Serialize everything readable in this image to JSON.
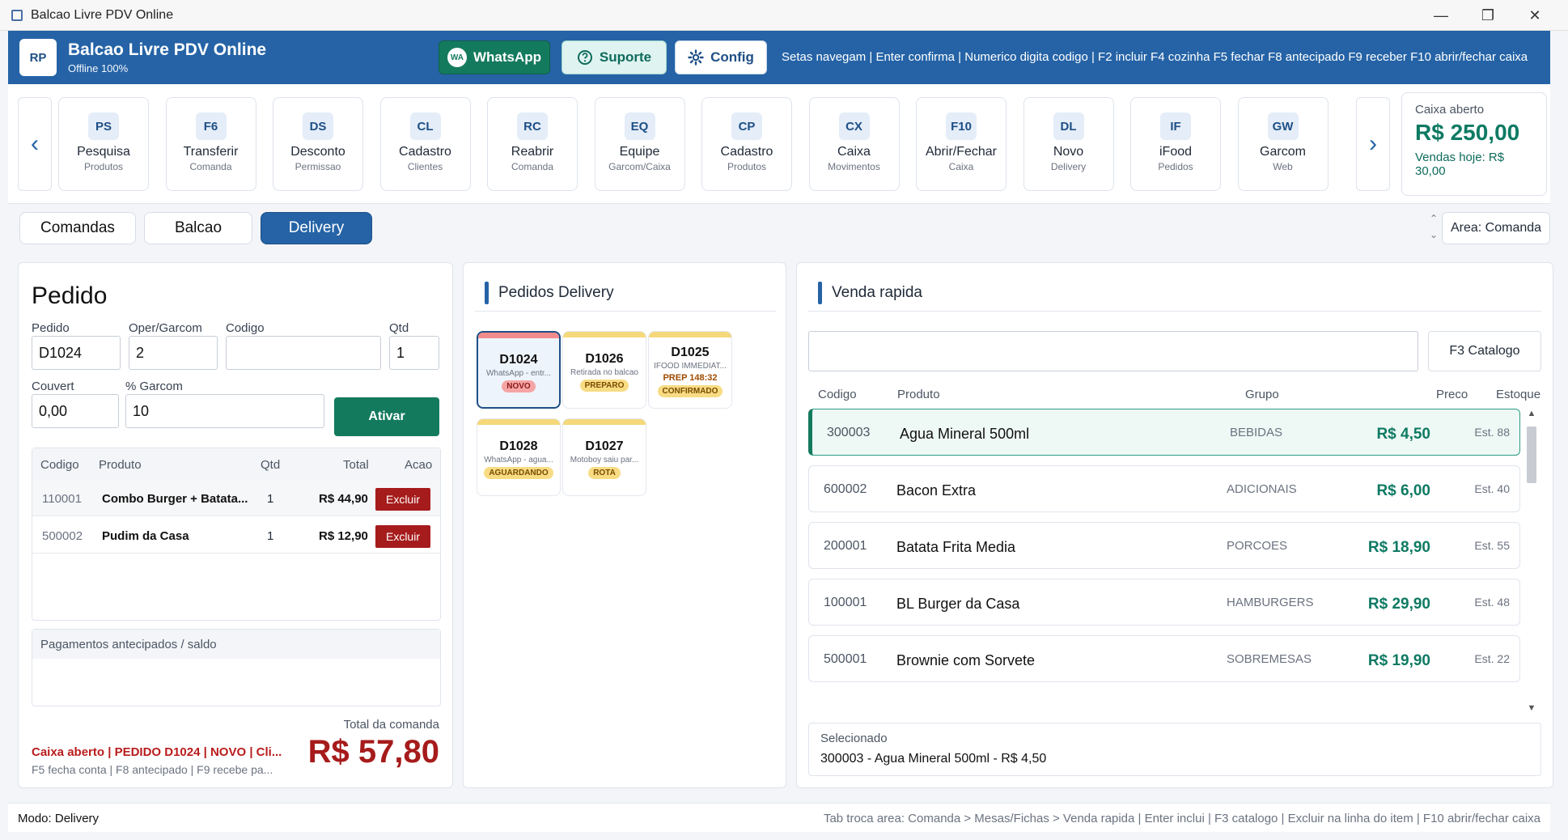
{
  "window": {
    "title": "Balcao Livre PDV Online",
    "minimize": "—",
    "maximize": "❐",
    "close": "✕"
  },
  "header": {
    "logo": "RP",
    "title": "Balcao Livre PDV Online",
    "subtitle": "Offline 100%",
    "buttons": {
      "whatsapp": "WhatsApp",
      "whatsapp_badge": "WA",
      "suporte": "Suporte",
      "config": "Config"
    },
    "shortcuts": "Setas navegam  |  Enter confirma  |  Numerico digita codigo  |  F2 incluir  F4 cozinha  F5 fechar  F8 antecipado  F9 receber  F10 abrir/fechar caixa"
  },
  "toolbar": {
    "prev": "‹",
    "next": "›",
    "tiles": [
      {
        "code": "PS",
        "label": "Pesquisa",
        "sub": "Produtos"
      },
      {
        "code": "F6",
        "label": "Transferir",
        "sub": "Comanda"
      },
      {
        "code": "DS",
        "label": "Desconto",
        "sub": "Permissao"
      },
      {
        "code": "CL",
        "label": "Cadastro",
        "sub": "Clientes"
      },
      {
        "code": "RC",
        "label": "Reabrir",
        "sub": "Comanda"
      },
      {
        "code": "EQ",
        "label": "Equipe",
        "sub": "Garcom/Caixa"
      },
      {
        "code": "CP",
        "label": "Cadastro",
        "sub": "Produtos"
      },
      {
        "code": "CX",
        "label": "Caixa",
        "sub": "Movimentos"
      },
      {
        "code": "F10",
        "label": "Abrir/Fechar",
        "sub": "Caixa"
      },
      {
        "code": "DL",
        "label": "Novo",
        "sub": "Delivery"
      },
      {
        "code": "IF",
        "label": "iFood",
        "sub": "Pedidos"
      },
      {
        "code": "GW",
        "label": "Garcom",
        "sub": "Web"
      }
    ],
    "cash": {
      "label": "Caixa aberto",
      "value": "R$ 250,00",
      "sales": "Vendas hoje: R$ 30,00"
    }
  },
  "tabs": {
    "comandas": "Comandas",
    "balcao": "Balcao",
    "delivery": "Delivery",
    "area": "Area: Comanda",
    "spin_up": "⌃",
    "spin_down": "⌄"
  },
  "pedido": {
    "title": "Pedido",
    "labels": {
      "pedido": "Pedido",
      "oper": "Oper/Garcom",
      "codigo": "Codigo",
      "qtd": "Qtd",
      "couvert": "Couvert",
      "garcom_pct": "% Garcom"
    },
    "values": {
      "pedido": "D1024",
      "oper": "2",
      "codigo": "",
      "qtd": "1",
      "couvert": "0,00",
      "garcom_pct": "10"
    },
    "ativar": "Ativar",
    "columns": {
      "codigo": "Codigo",
      "produto": "Produto",
      "qtd": "Qtd",
      "total": "Total",
      "acao": "Acao"
    },
    "items": [
      {
        "codigo": "110001",
        "produto": "Combo Burger + Batata...",
        "qtd": "1",
        "total": "R$ 44,90",
        "acao": "Excluir"
      },
      {
        "codigo": "500002",
        "produto": "Pudim da Casa",
        "qtd": "1",
        "total": "R$ 12,90",
        "acao": "Excluir"
      }
    ],
    "payments_header": "Pagamentos antecipados / saldo",
    "total_label": "Total da comanda",
    "total_value": "R$ 57,80",
    "status_line": "Caixa aberto  |  PEDIDO D1024  |  NOVO  |  Cli...",
    "hint_line": "F5 fecha conta  |  F8 antecipado  |  F9 recebe pa..."
  },
  "delivery": {
    "title": "Pedidos Delivery",
    "cards": [
      {
        "id": "D1024",
        "desc": "WhatsApp - entr...",
        "prep": "",
        "status": "NOVO",
        "color": "#f28b8b",
        "badge_bg": "#f6a5a5",
        "badge_fg": "#8b1a1a"
      },
      {
        "id": "D1026",
        "desc": "Retirada no balcao",
        "prep": "",
        "status": "PREPARO",
        "color": "#f5d87a",
        "badge_bg": "#f8dc84",
        "badge_fg": "#7a4b00"
      },
      {
        "id": "D1025",
        "desc": "IFOOD IMMEDIAT...",
        "prep": "PREP 148:32",
        "status": "CONFIRMADO",
        "color": "#f5d87a",
        "badge_bg": "#f8dc84",
        "badge_fg": "#7a4b00"
      },
      {
        "id": "D1028",
        "desc": "WhatsApp - agua...",
        "prep": "",
        "status": "AGUARDANDO",
        "color": "#f5d87a",
        "badge_bg": "#f8dc84",
        "badge_fg": "#7a4b00"
      },
      {
        "id": "D1027",
        "desc": "Motoboy saiu par...",
        "prep": "",
        "status": "ROTA",
        "color": "#f5d87a",
        "badge_bg": "#f8dc84",
        "badge_fg": "#7a4b00"
      }
    ]
  },
  "venda": {
    "title": "Venda rapida",
    "search_value": "",
    "catalog_button": "F3 Catalogo",
    "columns": {
      "codigo": "Codigo",
      "produto": "Produto",
      "grupo": "Grupo",
      "preco": "Preco",
      "estoque": "Estoque"
    },
    "products": [
      {
        "codigo": "300003",
        "produto": "Agua Mineral 500ml",
        "grupo": "BEBIDAS",
        "preco": "R$ 4,50",
        "estoque": "Est. 88"
      },
      {
        "codigo": "600002",
        "produto": "Bacon Extra",
        "grupo": "ADICIONAIS",
        "preco": "R$ 6,00",
        "estoque": "Est. 40"
      },
      {
        "codigo": "200001",
        "produto": "Batata Frita Media",
        "grupo": "PORCOES",
        "preco": "R$ 18,90",
        "estoque": "Est. 55"
      },
      {
        "codigo": "100001",
        "produto": "BL Burger da Casa",
        "grupo": "HAMBURGERS",
        "preco": "R$ 29,90",
        "estoque": "Est. 48"
      },
      {
        "codigo": "500001",
        "produto": "Brownie com Sorvete",
        "grupo": "SOBREMESAS",
        "preco": "R$ 19,90",
        "estoque": "Est. 22"
      }
    ],
    "selected_label": "Selecionado",
    "selected_value": "300003 - Agua Mineral 500ml - R$ 4,50",
    "scroll_up": "▲",
    "scroll_down": "▼"
  },
  "footer": {
    "mode": "Modo: Delivery",
    "hints": "Tab troca area: Comanda > Mesas/Fichas > Venda rapida  |  Enter inclui  |  F3 catalogo  |  Excluir na linha do item  |  F10 abrir/fechar caixa"
  }
}
